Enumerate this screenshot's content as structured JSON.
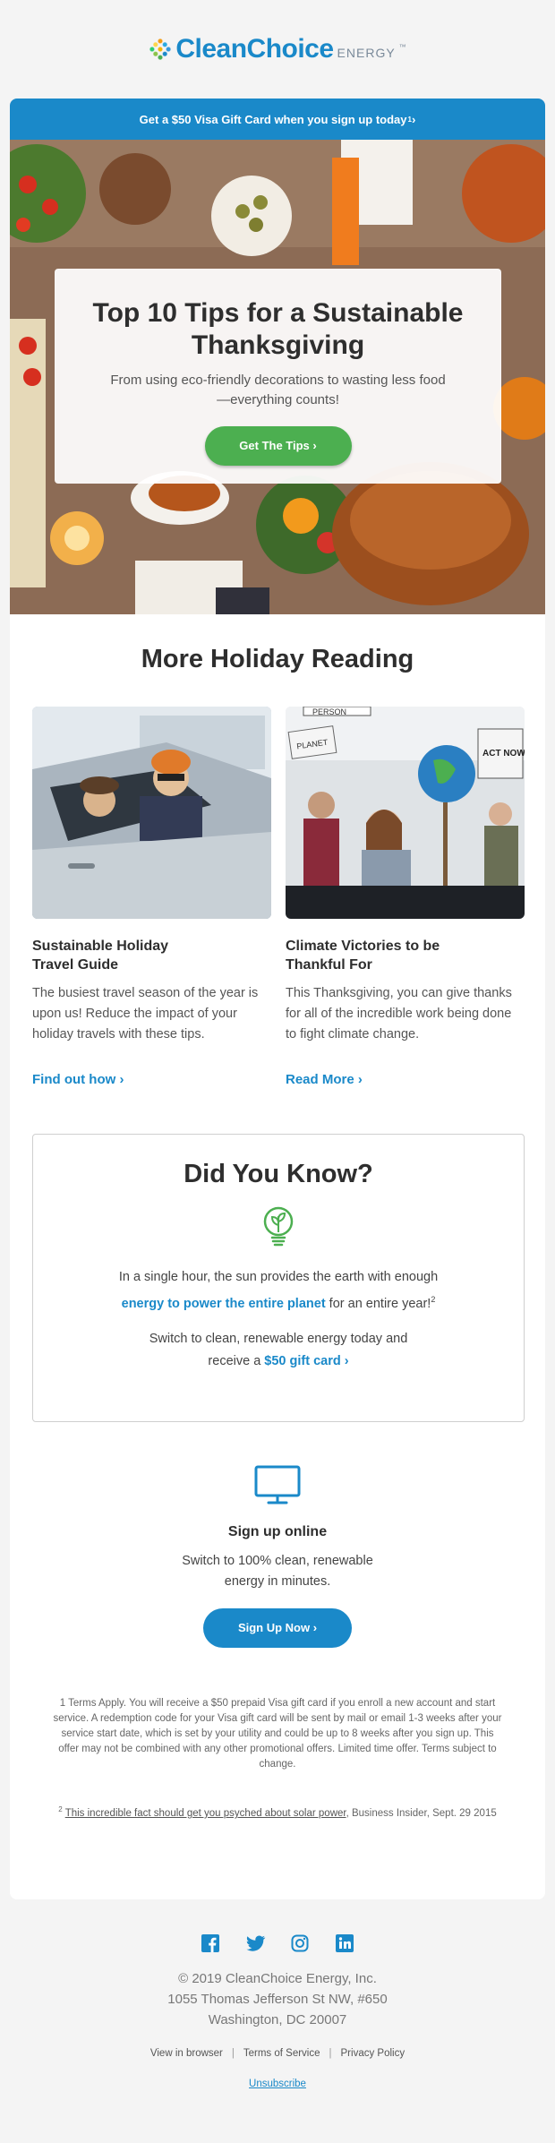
{
  "header": {
    "logo_main": "CleanChoice",
    "logo_energy": "ENERGY",
    "logo_tm": "™"
  },
  "banner": {
    "text": "Get a $50 Visa Gift Card when you sign up today",
    "sup": "1",
    "arrow": " ›"
  },
  "hero": {
    "title": "Top 10 Tips for a Sustainable Thanksgiving",
    "subtitle": "From using eco-friendly decorations to wasting less food—everything counts!",
    "button": "Get The Tips ›"
  },
  "reading": {
    "title": "More Holiday Reading",
    "articles": [
      {
        "title": "Sustainable Holiday Travel Guide",
        "text": "The busiest travel season of the year is upon us! Reduce the impact of your holiday travels with these tips.",
        "link": "Find out how ›"
      },
      {
        "title": "Climate Victories to be Thankful For",
        "text": "This Thanksgiving, you can give thanks for all of the incredible work being done to fight climate change.",
        "link": "Read More ›"
      }
    ],
    "protest_signs": [
      "PERSON",
      "PLANET",
      "ACT NOW"
    ]
  },
  "did_you_know": {
    "title": "Did You Know?",
    "fact_pre": "In a single hour, the sun provides the earth with enough",
    "fact_bold": "energy to power the entire planet",
    "fact_post": " for an entire year!",
    "fact_sup": "2",
    "cta_pre": "Switch to clean, renewable energy today and receive a ",
    "cta_link": "$50 gift card ›"
  },
  "signup": {
    "title": "Sign up online",
    "text": "Switch to 100% clean, renewable energy in minutes.",
    "button": "Sign Up Now ›"
  },
  "fineprint": {
    "note1": "1 Terms Apply. You will receive a $50 prepaid Visa gift card if you enroll a new account and start service. A redemption code for your Visa gift card will be sent by mail or email 1-3 weeks after your service start date, which is set by your utility and could be up to 8 weeks after you sign up. This offer may not be combined with any other promotional offers. Limited time offer. Terms subject to change.",
    "note2_sup": "2",
    "note2_link": "This incredible fact should get you psyched about solar power",
    "note2_rest": ", Business Insider, Sept. 29 2015"
  },
  "footer": {
    "social": [
      "facebook-icon",
      "twitter-icon",
      "instagram-icon",
      "linkedin-icon"
    ],
    "copyright": "© 2019 CleanChoice Energy, Inc.",
    "address1": "1055 Thomas Jefferson St NW, #650",
    "address2": "Washington, DC 20007",
    "links": [
      "View in browser",
      "Terms of Service",
      "Privacy Policy"
    ],
    "unsubscribe": "Unsubscribe"
  },
  "colors": {
    "brand_blue": "#1a89c9",
    "green": "#4caf50",
    "text_dark": "#2e2e2e"
  }
}
